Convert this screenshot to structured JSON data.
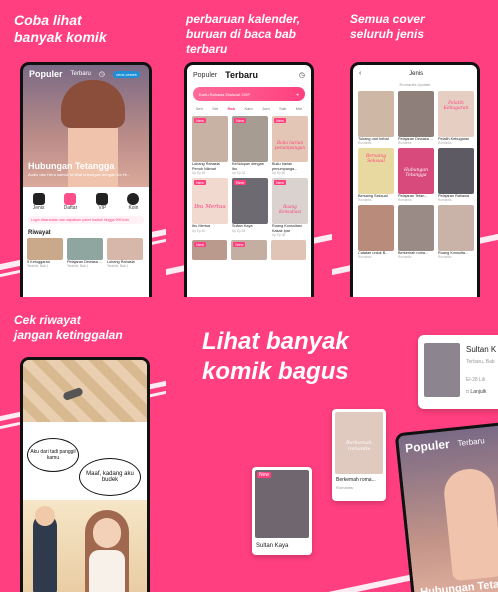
{
  "panels": {
    "p1": {
      "caption": "Coba lihat\nbanyak komik",
      "tabs": [
        "Populer",
        "Terbaru"
      ],
      "chip": "versi cewek",
      "hero_title": "Hubungan Tetangga",
      "hero_sub": "Audio dan Hera sama2 terlibat hubungan dengan Da Hi...",
      "menu": [
        "Jenis",
        "Daftar",
        "VIP",
        "Koin"
      ],
      "notice": "Login disarankan dan dapatkan paket hadiah hingga 999 koin",
      "section": "Riwayat",
      "history": [
        "5 Ketuggaran",
        "Pelajaran Dewasa ...",
        "Lubang Rahasia"
      ],
      "history_sub": [
        "Terakhir, Bab 1",
        "Terakhir, Bab 1",
        "Terakhir, Bab 1"
      ]
    },
    "p2": {
      "caption": "perbaruan kalender,\nburuan di baca bab terbaru",
      "tabs": [
        "Populer",
        "Terbaru"
      ],
      "banner": "Kartu Rahasia Ekskusif 2VIP",
      "days": [
        "Sen",
        "Sel",
        "Rab",
        "Kam",
        "Jum",
        "Sab",
        "Min"
      ],
      "cards": [
        {
          "title": "Lubang Rahasia Penuh Nikmat",
          "sub": "Up Ep.45"
        },
        {
          "title": "Kehidupan dengan Ibu",
          "sub": "Up Ep.32"
        },
        {
          "title": "Buku harian penumpanga...",
          "sub": "Up Ep.60"
        },
        {
          "title": "Ibu Mertua",
          "sub": "Up Ep.40"
        },
        {
          "title": "Sultan Kaya",
          "sub": "Up Ep.54"
        },
        {
          "title": "Ruang Konsultasi Kakak Ipar",
          "sub": "Up Ep.38"
        }
      ],
      "cover_texts": [
        "Buku harian penumpangan",
        "Ibu Mertua",
        "Ruang Konsultasi"
      ]
    },
    "p3": {
      "caption": "Semua cover\nseluruh jenis",
      "header": "Jenis",
      "sub_header": "Romantis Update",
      "cards": [
        {
          "title": "Tukang urut hebat",
          "sub": "Romantis"
        },
        {
          "title": "Pelajaran Dewasa ...",
          "sub": "Romantis"
        },
        {
          "title": "Pelatih Kebugaran",
          "sub": "Romantis"
        },
        {
          "title": "Bersaing Seksual",
          "sub": "Romantis"
        },
        {
          "title": "Pelajaran Tetan...",
          "sub": "Romantis"
        },
        {
          "title": "Pelajaran Rahasia",
          "sub": "Romantis"
        },
        {
          "title": "Catatan untuk B...",
          "sub": "Romantis"
        },
        {
          "title": "Berkemah roma...",
          "sub": "Romantis"
        },
        {
          "title": "Ruang Konsulta...",
          "sub": "Romantis"
        }
      ],
      "cover_texts": [
        "Pelatih Kebugaran",
        "Bersaing Seksual",
        "Hubungan Tetangga"
      ]
    },
    "p4": {
      "caption": "Cek riwayat\njangan ketinggalan",
      "bubble1": "Aku dari tadi panggil kamu",
      "bubble2": "Maaf, kadang aku budek"
    },
    "p5": {
      "caption": "Lihat banyak\nkomik bagus",
      "card_left_title": "Sultan Kaya",
      "card_left_badge": "New",
      "card_mid_title": "Berkemah roma...",
      "card_mid_sub": "Romantis",
      "card_mid_cover": "Berkemah romantis",
      "card_top_title": "Sultan K",
      "card_top_sub": "Terbaru, Bab",
      "card_top_extra": "El-28 Lik",
      "card_top_link": "Lanjutk",
      "phone_tabs": [
        "Populer",
        "Terbaru"
      ],
      "phone_title": "Hubungan Tetangga"
    }
  },
  "colors": {
    "brand": "#ff3f7f",
    "accent": "#ff4f8a",
    "white": "#ffffff"
  }
}
